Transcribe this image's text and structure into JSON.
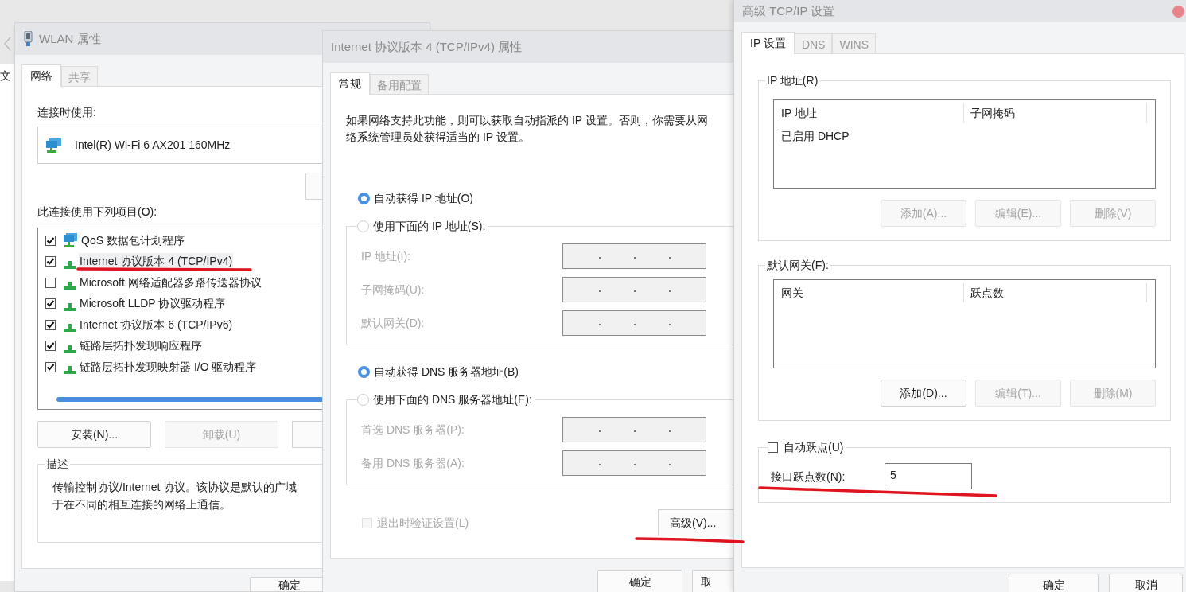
{
  "background": {
    "menu_text": "文"
  },
  "wlan_window": {
    "title": "WLAN 属性",
    "tabs": [
      {
        "label": "网络",
        "selected": true
      },
      {
        "label": "共享",
        "selected": false
      }
    ],
    "connect_using_label": "连接时使用:",
    "adapter": "Intel(R) Wi-Fi 6 AX201 160MHz",
    "items_label": "此连接使用下列项目(O):",
    "items": [
      {
        "label": "QoS 数据包计划程序",
        "checked": true,
        "selected": false,
        "kind": "service"
      },
      {
        "label": "Internet 协议版本 4 (TCP/IPv4)",
        "checked": true,
        "selected": true,
        "kind": "protocol"
      },
      {
        "label": "Microsoft 网络适配器多路传送器协议",
        "checked": false,
        "selected": false,
        "kind": "protocol"
      },
      {
        "label": "Microsoft LLDP 协议驱动程序",
        "checked": true,
        "selected": false,
        "kind": "protocol"
      },
      {
        "label": "Internet 协议版本 6 (TCP/IPv6)",
        "checked": true,
        "selected": false,
        "kind": "protocol"
      },
      {
        "label": "链路层拓扑发现响应程序",
        "checked": true,
        "selected": false,
        "kind": "protocol"
      },
      {
        "label": "链路层拓扑发现映射器 I/O 驱动程序",
        "checked": true,
        "selected": false,
        "kind": "protocol"
      }
    ],
    "buttons": [
      {
        "label": "安装(N)...",
        "disabled": false
      },
      {
        "label": "卸载(U)",
        "disabled": true
      }
    ],
    "description": {
      "title": "描述",
      "lines": [
        "传输控制协议/Internet 协议。该协议是默认的广域",
        "于在不同的相互连接的网络上通信。"
      ]
    },
    "footer_buttons": [
      {
        "label": "确定"
      }
    ]
  },
  "ipv4_window": {
    "title": "Internet 协议版本 4 (TCP/IPv4) 属性",
    "tabs": [
      {
        "label": "常规",
        "selected": true
      },
      {
        "label": "备用配置",
        "selected": false
      }
    ],
    "intro_lines": [
      "如果网络支持此功能，则可以获取自动指派的 IP 设置。否则，你需要从网",
      "络系统管理员处获得适当的 IP 设置。"
    ],
    "ip_options": [
      {
        "label": "自动获得 IP 地址(O)",
        "selected": true
      },
      {
        "label": "使用下面的 IP 地址(S):",
        "selected": false
      }
    ],
    "ip_fields": [
      {
        "label": "IP 地址(I):",
        "disabled": true
      },
      {
        "label": "子网掩码(U):",
        "disabled": true
      },
      {
        "label": "默认网关(D):",
        "disabled": true
      }
    ],
    "dns_options": [
      {
        "label": "自动获得 DNS 服务器地址(B)",
        "selected": true
      },
      {
        "label": "使用下面的 DNS 服务器地址(E):",
        "selected": false
      }
    ],
    "dns_fields": [
      {
        "label": "首选 DNS 服务器(P):",
        "disabled": true
      },
      {
        "label": "备用 DNS 服务器(A):",
        "disabled": true
      }
    ],
    "validate_checkbox": {
      "label": "退出时验证设置(L)",
      "checked": false,
      "disabled": true
    },
    "advanced_button": {
      "label": "高级(V)..."
    },
    "footer_buttons": [
      {
        "label": "确定"
      },
      {
        "label": "取"
      }
    ]
  },
  "advanced_window": {
    "title": "高级 TCP/IP 设置",
    "tabs": [
      {
        "label": "IP 设置",
        "selected": true
      },
      {
        "label": "DNS",
        "selected": false
      },
      {
        "label": "WINS",
        "selected": false
      }
    ],
    "ip_group": {
      "title": "IP 地址(R)",
      "columns": [
        "IP 地址",
        "子网掩码"
      ],
      "rows": [
        [
          "已启用 DHCP"
        ]
      ],
      "buttons": [
        {
          "label": "添加(A)...",
          "disabled": true
        },
        {
          "label": "编辑(E)...",
          "disabled": true
        },
        {
          "label": "删除(V)",
          "disabled": true
        }
      ]
    },
    "gateway_group": {
      "title": "默认网关(F):",
      "columns": [
        "网关",
        "跃点数"
      ],
      "buttons": [
        {
          "label": "添加(D)...",
          "disabled": false
        },
        {
          "label": "编辑(T)...",
          "disabled": true
        },
        {
          "label": "删除(M)",
          "disabled": true
        }
      ]
    },
    "metric": {
      "auto_label": "自动跃点(U)",
      "auto_checked": false,
      "label": "接口跃点数(N):",
      "value": "5"
    },
    "footer_buttons": [
      {
        "label": "确定"
      },
      {
        "label": "取消"
      }
    ]
  }
}
